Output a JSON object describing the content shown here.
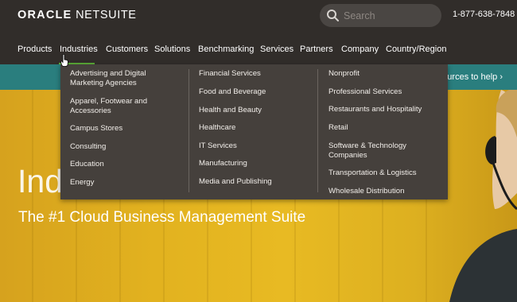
{
  "header": {
    "logo_oracle": "ORACLE",
    "logo_netsuite": "NETSUITE",
    "search_placeholder": "Search",
    "phone": "1-877-638-7848"
  },
  "nav": {
    "items": [
      "Products",
      "Industries",
      "Customers",
      "Solutions",
      "Benchmarking",
      "Services",
      "Partners",
      "Company",
      "Country/Region"
    ],
    "active": "Industries",
    "active_color": "#5aab38"
  },
  "banner": {
    "text": "sources to help ›"
  },
  "hero": {
    "title": "Ind",
    "subtitle": "The #1 Cloud Business Management Suite"
  },
  "industries_menu": {
    "columns": [
      [
        "Advertising and Digital Marketing Agencies",
        "Apparel, Footwear and Accessories",
        "Campus Stores",
        "Consulting",
        "Education",
        "Energy"
      ],
      [
        "Financial Services",
        "Food and Beverage",
        "Health and Beauty",
        "Healthcare",
        "IT Services",
        "Manufacturing",
        "Media and Publishing"
      ],
      [
        "Nonprofit",
        "Professional Services",
        "Restaurants and Hospitality",
        "Retail",
        "Software & Technology Companies",
        "Transportation & Logistics",
        "Wholesale Distribution"
      ]
    ]
  },
  "colors": {
    "header_bg": "#312d2a",
    "banner_bg": "#2a7e7e",
    "menu_bg": "#45403c",
    "hero_yellow": "#e2b21f"
  }
}
